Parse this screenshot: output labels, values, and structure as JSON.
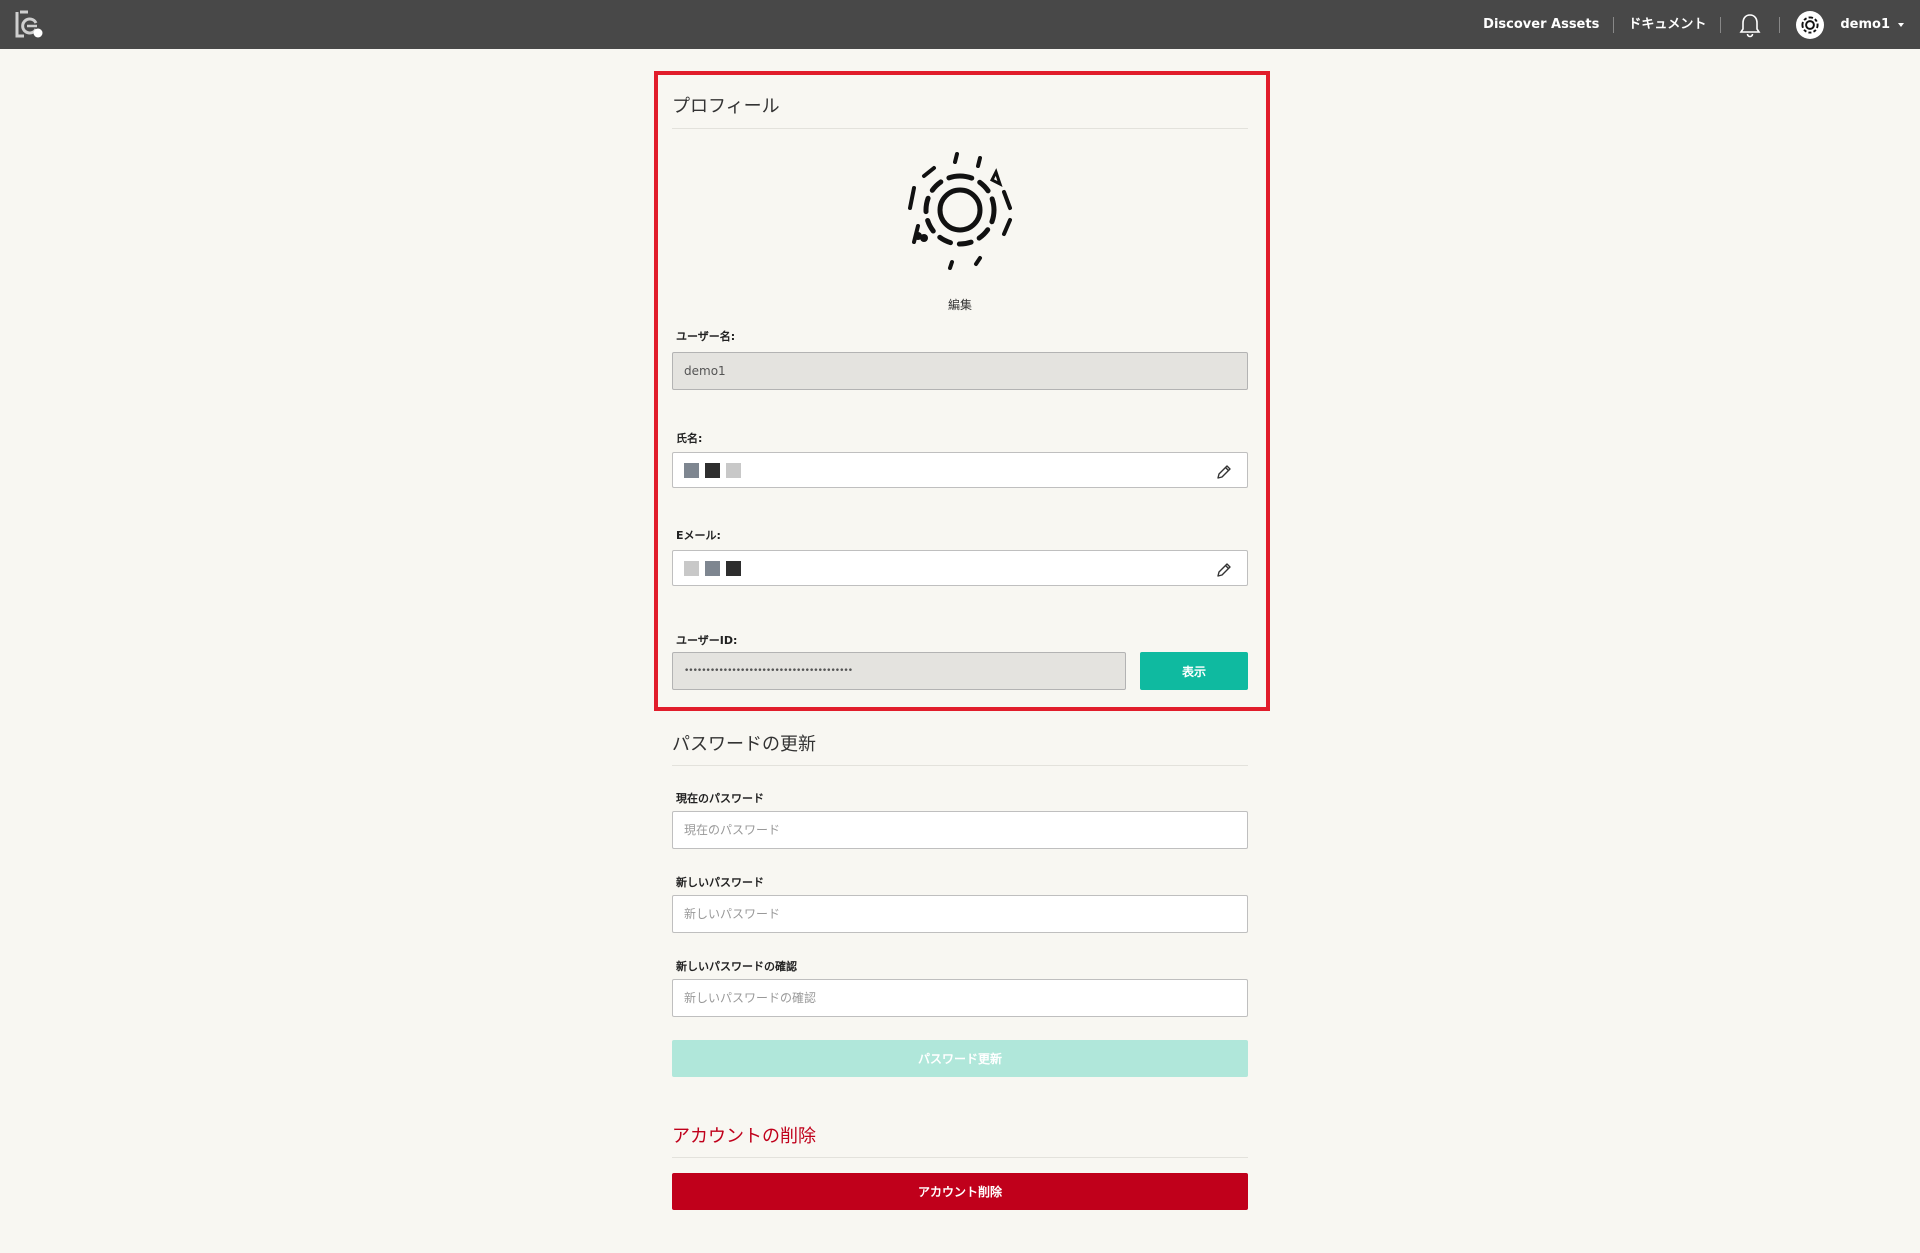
{
  "topbar": {
    "nav": [
      "Discover Assets",
      "ドキュメント"
    ],
    "username": "demo1"
  },
  "profile": {
    "title": "プロフィール",
    "edit_label": "編集",
    "username_label": "ユーザー名:",
    "username_value": "demo1",
    "fullname_label": "氏名:",
    "fullname_squares": [
      "#7e8690",
      "#2e2e2e",
      "#c8c8c8"
    ],
    "email_label": "Eメール:",
    "email_squares": [
      "#c8c8c8",
      "#7e8690",
      "#2e2e2e"
    ],
    "userid_label": "ユーザーID:",
    "userid_masked": "•••••••••••••••••••••••••••••••••••••••",
    "show_button": "表示"
  },
  "password": {
    "title": "パスワードの更新",
    "current_label": "現在のパスワード",
    "current_placeholder": "現在のパスワード",
    "new_label": "新しいパスワード",
    "new_placeholder": "新しいパスワード",
    "confirm_label": "新しいパスワードの確認",
    "confirm_placeholder": "新しいパスワードの確認",
    "update_button": "パスワード更新"
  },
  "account": {
    "title": "アカウントの削除",
    "delete_button": "アカウント削除"
  },
  "colors": {
    "topbar": "#484848",
    "accent": "#0fbaa0",
    "danger": "#c0001b",
    "highlight": "#e11d2b"
  }
}
